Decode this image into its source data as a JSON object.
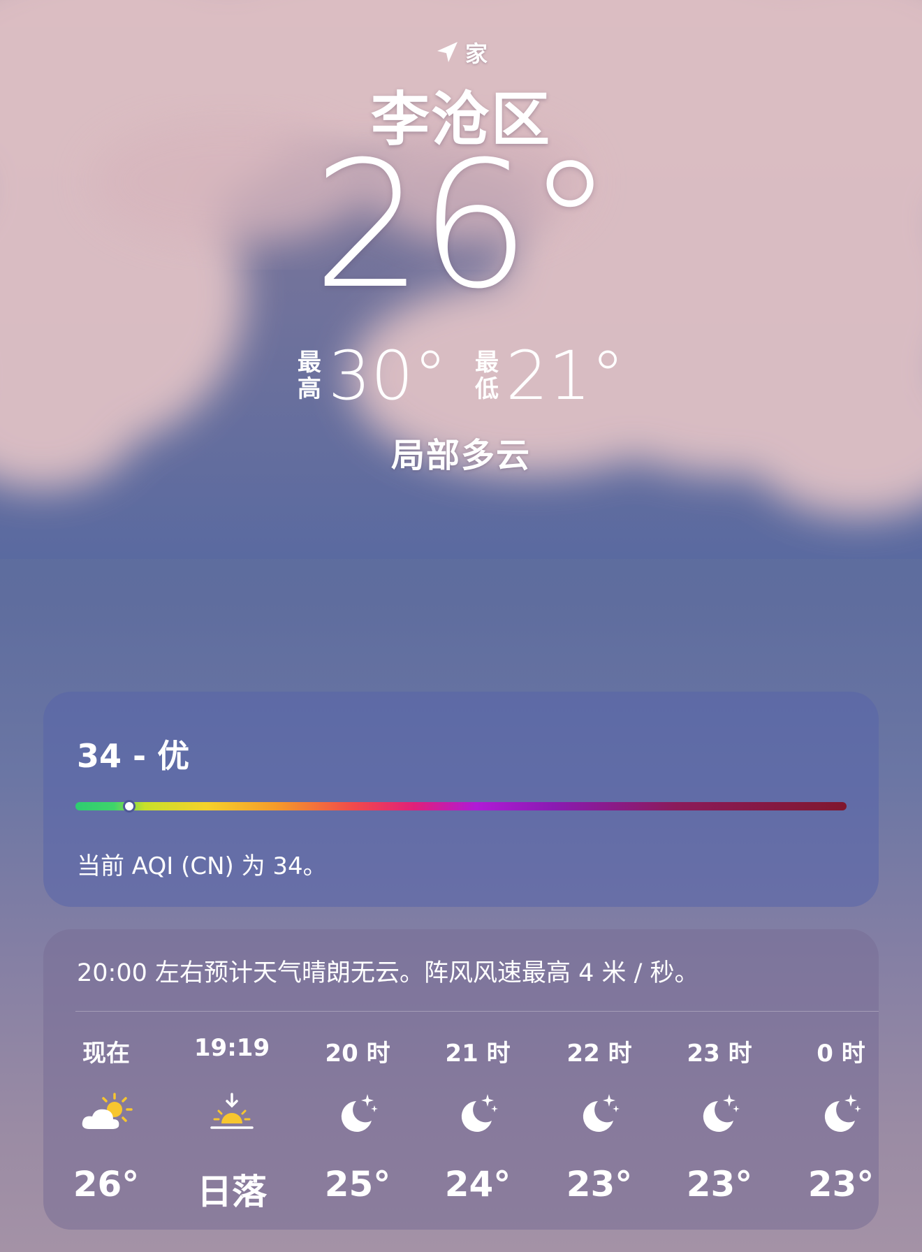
{
  "header": {
    "location_tag": "家",
    "city": "李沧区",
    "current_temp": "26°",
    "high_label": [
      "最",
      "高"
    ],
    "high_value": "30°",
    "low_label": [
      "最",
      "低"
    ],
    "low_value": "21°",
    "condition": "局部多云"
  },
  "aqi": {
    "title": "34 - 优",
    "value_fraction": 0.07,
    "description": "当前 AQI (CN) 为 34。"
  },
  "hourly": {
    "summary": "20:00 左右预计天气晴朗无云。阵风风速最高 4 米 / 秒。",
    "items": [
      {
        "label": "现在",
        "icon": "partly-cloudy-sun-icon",
        "temp": "26°"
      },
      {
        "label": "19:19",
        "icon": "sunset-icon",
        "temp": "日落"
      },
      {
        "label": "20 时",
        "icon": "moon-stars-icon",
        "temp": "25°"
      },
      {
        "label": "21 时",
        "icon": "moon-stars-icon",
        "temp": "24°"
      },
      {
        "label": "22 时",
        "icon": "moon-stars-icon",
        "temp": "23°"
      },
      {
        "label": "23 时",
        "icon": "moon-stars-icon",
        "temp": "23°"
      },
      {
        "label": "0 时",
        "icon": "moon-stars-icon",
        "temp": "23°"
      }
    ]
  },
  "colors": {
    "sun_yellow": "#f7c62f",
    "aqi_good": "#2ecc71"
  }
}
